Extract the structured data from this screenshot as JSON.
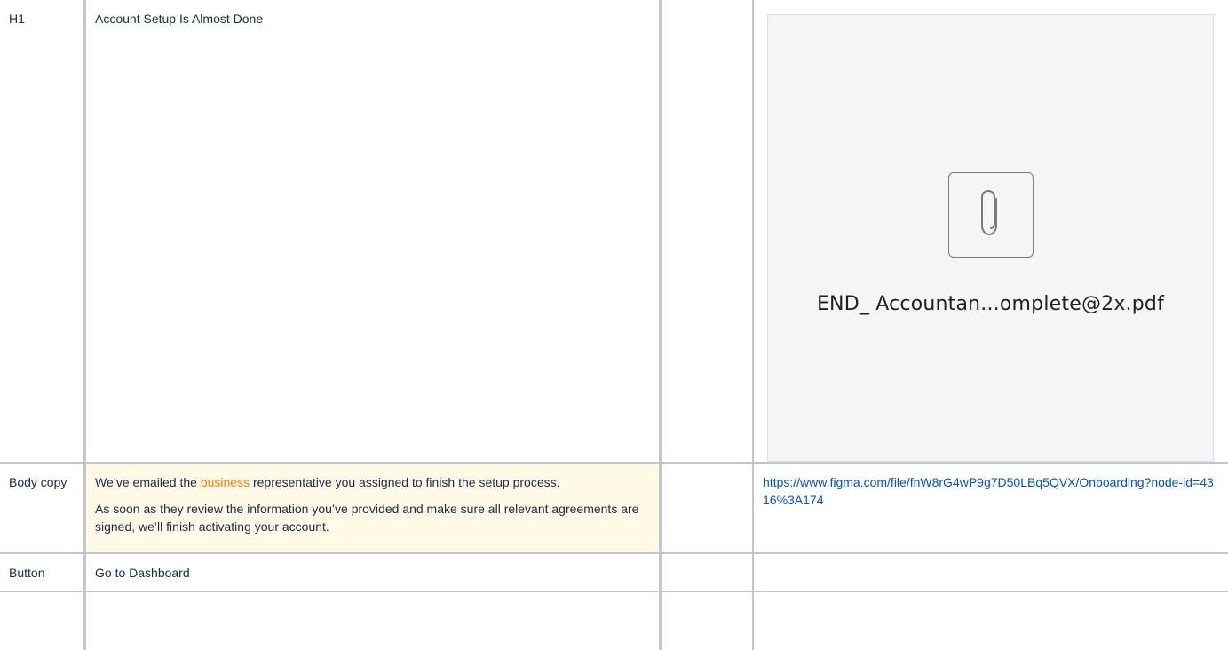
{
  "rows": [
    {
      "label": "H1",
      "content": "Account Setup Is Almost Done"
    },
    {
      "label": "Body copy",
      "paragraph1_before": "We’ve emailed the ",
      "paragraph1_accent": "business",
      "paragraph1_after": " representative you assigned to finish the setup process.",
      "paragraph2": "As soon as they review the information you’ve provided and make sure all relevant agreements are signed, we’ll finish activating your account.",
      "link": "https://www.figma.com/file/fnW8rG4wP9g7D50LBq5QVX/Onboarding?node-id=4316%3A174"
    },
    {
      "label": "Button",
      "content": "Go to Dashboard"
    }
  ],
  "attachment": {
    "icon": "paperclip-icon",
    "filename": "END_ Accountan...omplete@2x.pdf"
  },
  "colors": {
    "highlight_bg": "#fffae6",
    "accent_text": "#ff7a00",
    "link": "#0052cc",
    "grid_line": "#c1c7d0"
  }
}
